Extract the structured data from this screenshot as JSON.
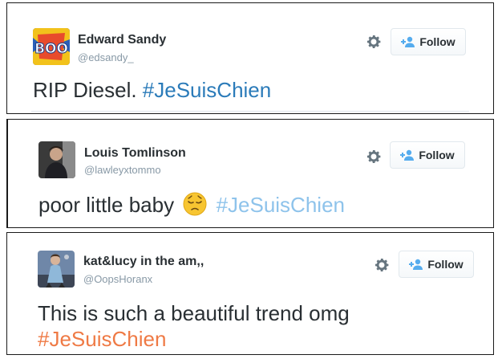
{
  "follow_label": "Follow",
  "colors": {
    "hashtag_blue": "#2b7bb9",
    "hashtag_lightblue": "#8ec3eb",
    "hashtag_orange": "#ef7a45",
    "name": "#292f33",
    "handle": "#8899a6"
  },
  "tweets": [
    {
      "name": "Edward Sandy",
      "handle": "@edsandy_",
      "text": "RIP Diesel.",
      "hashtag": "#JeSuisChien",
      "hashtag_color": "#2b7bb9",
      "avatar_icon": "boom-comic-avatar"
    },
    {
      "name": "Louis Tomlinson",
      "handle": "@lawleyxtommo",
      "text": "poor little baby",
      "emoji_icon": "pensive-face-emoji",
      "hashtag": "#JeSuisChien",
      "hashtag_color": "#8ec3eb",
      "avatar_icon": "person-photo-avatar"
    },
    {
      "name": "kat&lucy in the am,,",
      "handle": "@OopsHoranx",
      "text": "This is such a beautiful trend omg",
      "hashtag": "#JeSuisChien",
      "hashtag_color": "#ef7a45",
      "avatar_icon": "performer-photo-avatar"
    }
  ]
}
